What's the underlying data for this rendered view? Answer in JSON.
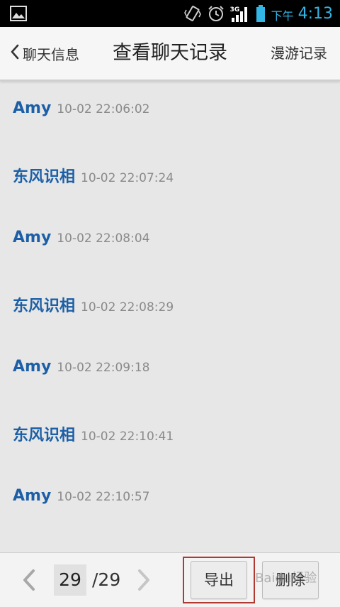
{
  "status_bar": {
    "network": "3G",
    "ampm": "下午",
    "time": "4:13"
  },
  "header": {
    "back_label": "聊天信息",
    "title": "查看聊天记录",
    "roam_label": "漫游记录"
  },
  "messages": [
    {
      "sender": "Amy",
      "time": "10-02 22:06:02"
    },
    {
      "sender": "东风识相",
      "time": "10-02 22:07:24"
    },
    {
      "sender": "Amy",
      "time": "10-02 22:08:04"
    },
    {
      "sender": "东风识相",
      "time": "10-02 22:08:29"
    },
    {
      "sender": "Amy",
      "time": "10-02 22:09:18"
    },
    {
      "sender": "东风识相",
      "time": "10-02 22:10:41"
    },
    {
      "sender": "Amy",
      "time": "10-02 22:10:57"
    }
  ],
  "footer": {
    "current_page": "29",
    "total_pages": "/29",
    "export_label": "导出",
    "delete_label": "删除"
  },
  "watermark": "Baidu经验",
  "colors": {
    "accent": "#33b5e5",
    "sender": "#1c5fa6",
    "highlight_frame": "#b03a32"
  }
}
